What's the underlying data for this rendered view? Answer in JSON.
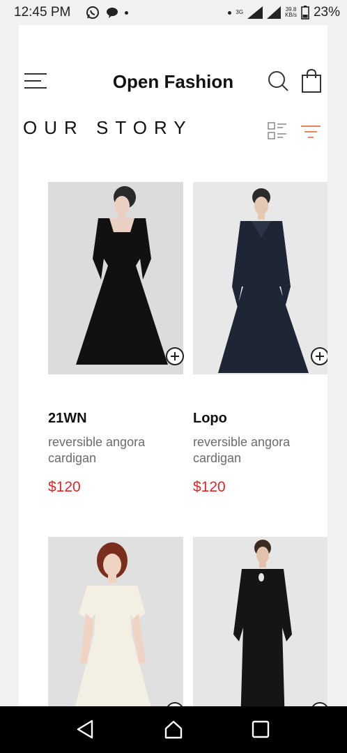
{
  "status_bar": {
    "time": "12:45 PM",
    "network_type": "3G",
    "speed_value": "39.8",
    "speed_unit": "KB/s",
    "battery": "23%",
    "icons": [
      "whatsapp-icon",
      "chat-icon",
      "dot-icon",
      "signal-icon",
      "battery-icon"
    ]
  },
  "header": {
    "title": "Open Fashion",
    "icons": [
      "menu-icon",
      "search-icon",
      "bag-icon"
    ]
  },
  "section": {
    "title": "OUR STORY",
    "icons": [
      "list-view-icon",
      "filter-icon"
    ],
    "accent_color": "#e8855a"
  },
  "products": [
    {
      "name": "21WN",
      "description": "reversible angora cardigan",
      "price": "$120",
      "image": "black-dress-photo"
    },
    {
      "name": "Lopo",
      "description": "reversible angora cardigan",
      "price": "$120",
      "image": "navy-dress-photo"
    },
    {
      "name": "",
      "description": "",
      "price": "",
      "image": "cream-dress-photo"
    },
    {
      "name": "",
      "description": "",
      "price": "",
      "image": "black-keyhole-dress-photo"
    }
  ],
  "colors": {
    "price": "#e0262b",
    "background": "#ffffff",
    "navbar": "#000000"
  },
  "nav_bar": {
    "icons": [
      "back-icon",
      "home-icon",
      "recents-icon"
    ]
  }
}
